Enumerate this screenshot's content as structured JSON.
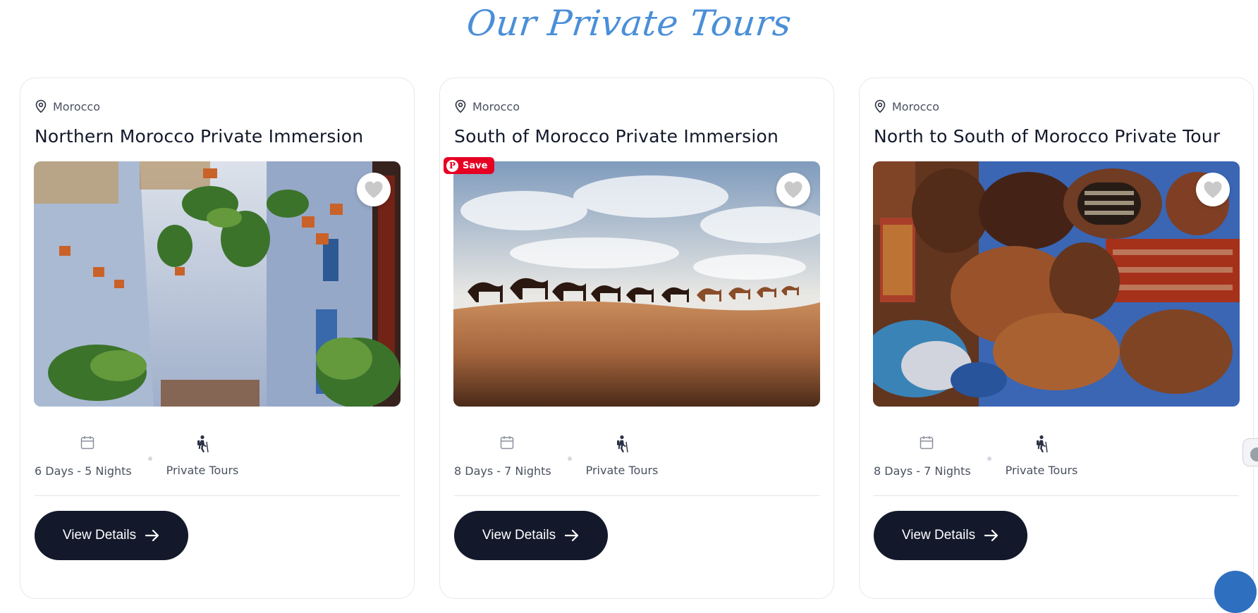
{
  "section": {
    "title": "Our Private Tours"
  },
  "tours": [
    {
      "location": "Morocco",
      "title": "Northern Morocco Private Immersion",
      "duration": "6 Days - 5 Nights",
      "type": "Private Tours",
      "button": "View Details",
      "image": "chefchaouen-blue-street-with-flower-pots"
    },
    {
      "location": "Morocco",
      "title": "South of Morocco Private Immersion",
      "duration": "8 Days - 7 Nights",
      "type": "Private Tours",
      "button": "View Details",
      "image": "camel-caravan-desert-dunes",
      "pin_save": "Save",
      "pin_logo": "P"
    },
    {
      "location": "Morocco",
      "title": "North to South of Morocco Private Tour",
      "duration": "8 Days - 7 Nights",
      "type": "Private Tours",
      "button": "View Details",
      "image": "moroccan-leather-bags-and-rugs"
    }
  ],
  "colors": {
    "title_blue": "#4a8fd8",
    "button_bg": "#13192b",
    "pinterest_red": "#e60023"
  },
  "icons": [
    "map-pin-icon",
    "heart-icon",
    "calendar-icon",
    "hiker-icon",
    "arrow-right-icon",
    "pinterest-icon"
  ]
}
